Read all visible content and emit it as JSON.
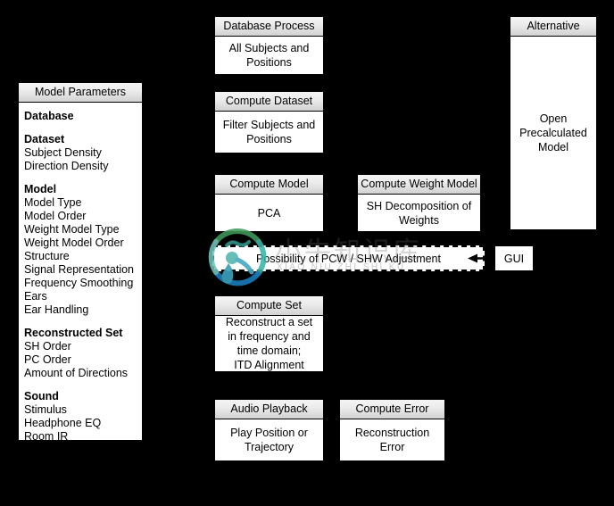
{
  "model_parameters": {
    "title": "Model Parameters",
    "groups": [
      {
        "title": "Database",
        "items": []
      },
      {
        "title": "Dataset",
        "items": [
          "Subject Density",
          "Direction Density"
        ]
      },
      {
        "title": "Model",
        "items": [
          "Model Type",
          "Model Order",
          "Weight Model Type",
          "Weight Model Order",
          "Structure",
          "Signal Representation",
          "Frequency Smoothing",
          "Ears",
          "Ear Handling"
        ]
      },
      {
        "title": "Reconstructed Set",
        "items": [
          "SH Order",
          "PC Order",
          "Amount of Directions"
        ]
      },
      {
        "title": "Sound",
        "items": [
          "Stimulus",
          "Headphone EQ",
          "Room IR"
        ]
      }
    ]
  },
  "boxes": {
    "database_process": {
      "header": "Database Process",
      "body": [
        "All Subjects and",
        "Positions"
      ]
    },
    "compute_dataset": {
      "header": "Compute Dataset",
      "body": [
        "Filter Subjects and",
        "Positions"
      ]
    },
    "compute_model": {
      "header": "Compute Model",
      "body": [
        "PCA"
      ]
    },
    "compute_weight_model": {
      "header": "Compute Weight Model",
      "body": [
        "SH Decomposition of",
        "Weights"
      ]
    },
    "compute_set": {
      "header": "Compute Set",
      "body": [
        "Reconstruct a set",
        "in frequency and",
        "time domain;",
        "ITD Alignment"
      ]
    },
    "audio_playback": {
      "header": "Audio Playback",
      "body": [
        "Play Position or",
        "Trajectory"
      ]
    },
    "compute_error": {
      "header": "Compute Error",
      "body": [
        "Reconstruction",
        "Error"
      ]
    },
    "alternative": {
      "header": "Alternative",
      "body": [
        "Open",
        "Precalculated",
        "Model"
      ]
    }
  },
  "adjustment": {
    "label": "Possibility of PCW / SHW Adjustment"
  },
  "gui": {
    "label": "GUI"
  },
  "watermark": {
    "cn": "小牛知识库",
    "en": "XIAO NIU ZHI SHI KU"
  },
  "colors": {
    "background": "#000000",
    "panel_bg": "#ffffff",
    "border": "#000000",
    "header_top": "#f4f4f4",
    "header_bottom": "#d2d2d2",
    "text": "#000000"
  }
}
